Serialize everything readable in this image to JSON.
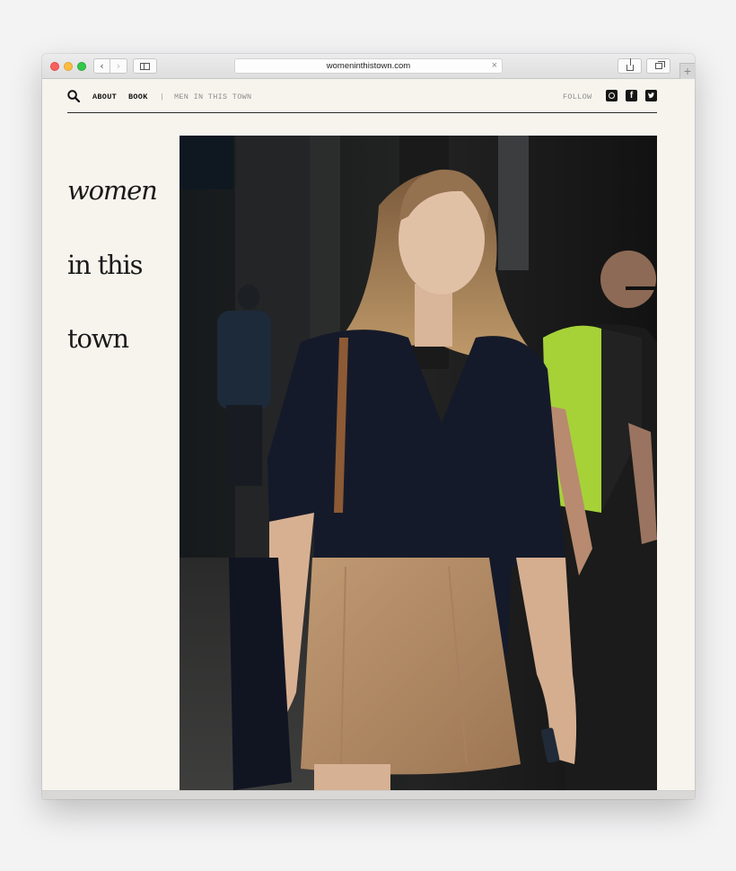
{
  "browser": {
    "url": "womeninthistown.com",
    "back_glyph": "‹",
    "forward_glyph": "›",
    "close_glyph": "×",
    "new_tab_glyph": "+"
  },
  "nav": {
    "links": [
      {
        "label": "ABOUT",
        "icon": "none"
      },
      {
        "label": "BOOK",
        "icon": "none"
      },
      {
        "label": "|",
        "icon": "none"
      },
      {
        "label": "MEN IN THIS TOWN",
        "icon": "none"
      }
    ],
    "follow_label": "FOLLOW",
    "social": [
      {
        "icon": "instagram-icon"
      },
      {
        "icon": "facebook-icon",
        "glyph": "f"
      },
      {
        "icon": "twitter-icon"
      }
    ]
  },
  "logo": {
    "line1": "women",
    "line2": "in this",
    "line3": "town"
  },
  "colors": {
    "page_background": "#f7f4ee",
    "text": "#111111",
    "muted": "#8b8b8b"
  }
}
